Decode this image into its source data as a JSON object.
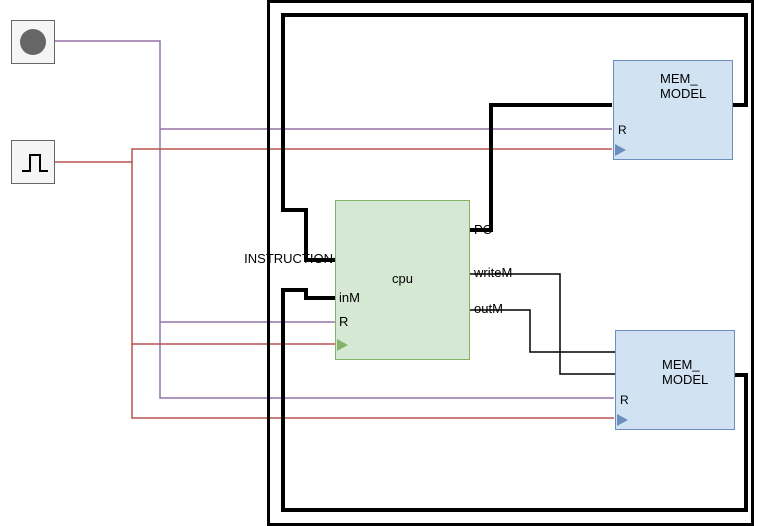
{
  "outer": {
    "role": "system-boundary"
  },
  "reset_source": {
    "icon": "filled-circle-icon",
    "role": "reset"
  },
  "clock_source": {
    "icon": "square-wave-icon",
    "role": "clock"
  },
  "mem_top": {
    "label": "MEM_\nMODEL",
    "ports": {
      "R": "R"
    }
  },
  "mem_bottom": {
    "label": "MEM_\nMODEL",
    "ports": {
      "R": "R"
    }
  },
  "cpu": {
    "label": "cpu",
    "ports": {
      "instruction": "INSTRUCTION",
      "inM": "inM",
      "R": "R",
      "PC": "PC",
      "writeM": "writeM",
      "outM": "outM"
    }
  },
  "colors": {
    "reset_wire": "#9673a6",
    "clock_wire": "#b85450",
    "bus": "#000000"
  }
}
